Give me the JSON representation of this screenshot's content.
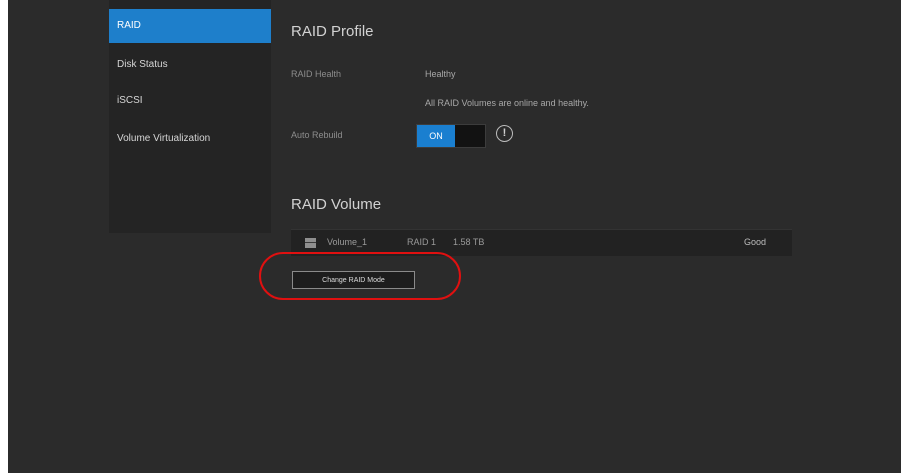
{
  "sidebar": {
    "items": [
      {
        "label": "RAID"
      },
      {
        "label": "Disk Status"
      },
      {
        "label": "iSCSI"
      },
      {
        "label": "Volume Virtualization"
      }
    ]
  },
  "raid_profile": {
    "title": "RAID Profile",
    "raid_health_label": "RAID Health",
    "raid_health_value": "Healthy",
    "raid_health_desc": "All RAID Volumes are online and healthy.",
    "auto_rebuild_label": "Auto Rebuild",
    "toggle_on": "ON",
    "toggle_off": "",
    "info_icon_glyph": "!"
  },
  "raid_volume": {
    "title": "RAID Volume",
    "row": {
      "name": "Volume_1",
      "level": "RAID 1",
      "size": "1.58 TB",
      "status": "Good"
    },
    "change_button": "Change RAID Mode"
  },
  "colors": {
    "accent": "#1e7fcb",
    "highlight": "#e01010",
    "background": "#2b2b2b"
  }
}
